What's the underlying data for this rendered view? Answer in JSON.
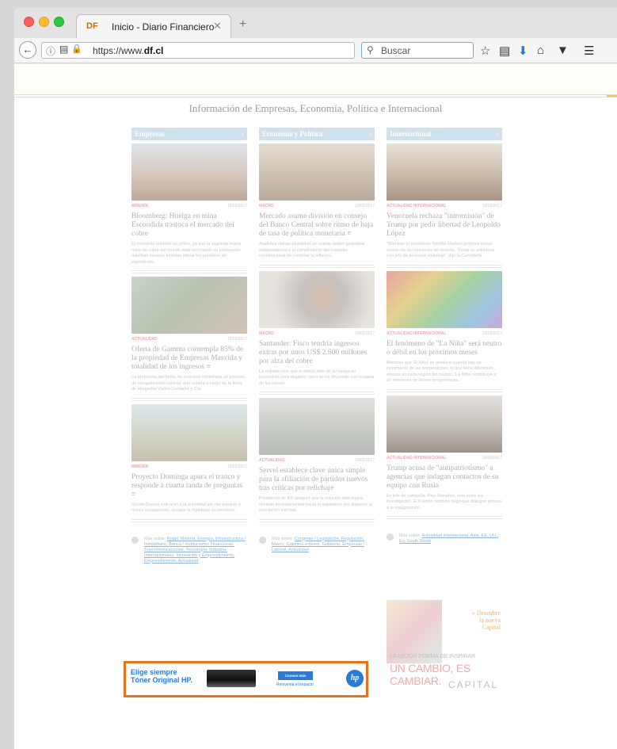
{
  "browser": {
    "tab": {
      "favicon": "DF",
      "title": "Inicio - Diario Financiero",
      "close": "✕"
    },
    "new_tab": "+",
    "url": {
      "prefix": "https://www.",
      "domain": "df.cl"
    },
    "search_placeholder": "Buscar",
    "icons": [
      "info-icon",
      "reader-icon",
      "lock-icon",
      "reload-icon",
      "search-icon",
      "bookmark-star-icon",
      "library-icon",
      "download-icon",
      "home-icon",
      "pocket-icon",
      "menu-icon"
    ]
  },
  "page": {
    "section_title": "Información de Empresas, Economía, Política e Internacional",
    "columns": [
      {
        "heading": "Empresas",
        "articles": [
          {
            "category": "MINERÍA",
            "date": "10/02/2017",
            "headline": "Bloomberg: Huelga en mina Escondida trastoca el mercado del cobre",
            "lead": "El momento también es crítico, ya que la segunda mayor mina de cobre del mundo está recortando su producción mientras mineros intentan elevar los permisos de exportación."
          },
          {
            "category": "ACTUALIDAD",
            "date": "10/02/2017",
            "headline": "Oferta de Gamma contempla 85% de la propiedad de Empresas Masvida y totalidad de los ingresos ≡",
            "lead": "La propuesta del fondo de inversión contempla un proceso de reorganización judicial, que estaría a cargo de la firma de abogados Varlen Contador y Cía."
          },
          {
            "category": "MINERÍA",
            "date": "10/02/2017",
            "headline": "Proyecto Dominga apura el tranco y responde a cuarta tanda de preguntas ≡",
            "lead": "Desde Dosera criticaron a la autoridad por dar espacio a marzo acusaciones, aunque la digitalizar su permisos."
          }
        ],
        "more_label": "Más sobre:",
        "more_links": "Retail, Minería, Energía, Infraestructura / Inmobiliario, Banca / Instituciones Financieras, Telecomunicaciones, Tecnología, Industria, Internacionales, Innovación y Emprendimiento, Emprendimiento, Actualidad"
      },
      {
        "heading": "Economía y Política",
        "articles": [
          {
            "category": "MACRO",
            "date": "10/02/2017",
            "headline": "Mercado asume división en consejo del Banco Central sobre ritmo de baja de tasa de política monetaria ≡",
            "lead": "Analistas ubican pluralidad en cuanto deben garantizar independencia y el cumplimiento del mandato constitucional de controlar la inflación."
          },
          {
            "category": "MACRO",
            "date": "10/02/2017",
            "headline": "Santander: Fisco tendría ingresos extras por unos US$ 2.600 millones por alza del cobre",
            "lead": "La entidad cree que el efecto neto de la huelga en Escondida será negativo, pero se irá diluyendo con el pasar de los meses."
          },
          {
            "category": "ACTUALIDAD",
            "date": "10/02/2017",
            "headline": "Servel establece clave única simple para la afiliación de partidos nuevos tras críticas por refichaje",
            "lead": "Presidente de RD aseguró que la solución está lejana eliminar inconvenientes hacia el organismo por disponer la inscripción vía mail."
          }
        ],
        "more_label": "Más sobre:",
        "more_links": "Congreso / Legislación, Regulación, Macro, Gabinete externo, Gobierno, Empresas / Laboral, Actualidad"
      },
      {
        "heading": "Internacional",
        "articles": [
          {
            "category": "ACTUALIDAD INTERNACIONAL",
            "date": "10/02/2017",
            "headline": "Venezuela rechaza \"intromisión\" de Trump por pedir libertad de Leopoldo López",
            "lead": "\"Mientras el presidente Nicolás Maduro propone iniciar nueva ola de relaciones de respeto, Trump se solidariza con jefe de acciones violentas\", dijo la Cancillería."
          },
          {
            "category": "ACTUALIDAD INTERNACIONAL",
            "date": "10/02/2017",
            "headline": "El fenómeno de \"La Niña\" será neutro o débil en los próximos meses",
            "lead": "Mientras que 'El Niño' se produce cuando hay un incremento de las temperaturas, lo que tiene diferentes efectos en cada región del mundo. 'La Niña' contribuye a un descenso de dichas temperaturas."
          },
          {
            "category": "ACTUALIDAD INTERNACIONAL",
            "date": "10/02/2017",
            "headline": "Trump acusa de \"antipatriotismo\" a agencias que indagan contactos de su equipo con Rusia",
            "lead": "Ex jefe de campaña, Paul Manafort, está entre los investigados. El Kremlin también negó que diálogos previos a la inauguración."
          }
        ],
        "more_label": "Más sobre:",
        "more_links": "Actualidad Internacional, Asia, EE. UU., Eu, South Shore"
      }
    ],
    "ad_hp": {
      "line1": "Elige siempre",
      "line2": "Tóner Original HP.",
      "button": "Conoce más",
      "sub": "Reinventa el impacto",
      "logo": "hp"
    },
    "ad_capital": {
      "describe1": "» Descubre",
      "describe2": "la nueva",
      "describe3": "Capital",
      "tagline1": "LA MEJOR FORMA DE INSPIRAR",
      "tagline2": "UN CAMBIO, ES CAMBIAR.",
      "logo": "CAPITAL"
    }
  }
}
